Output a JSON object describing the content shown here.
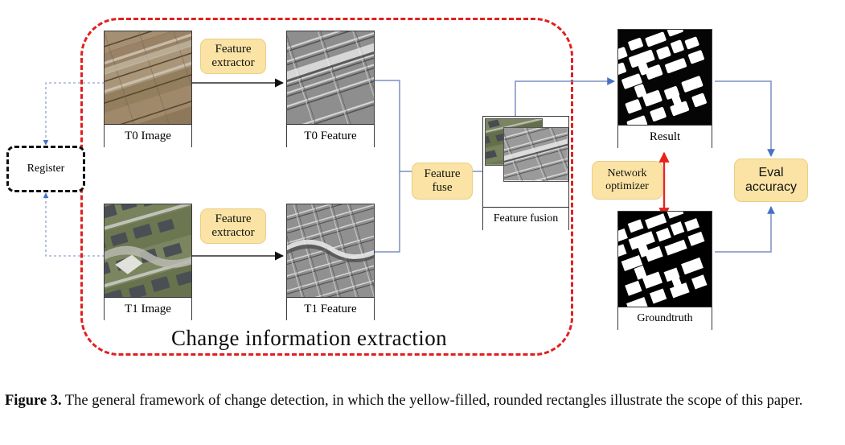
{
  "figure": {
    "scope_label": "Change  information  extraction",
    "caption_lead": "Figure 3.",
    "caption_text": " The general framework of change detection, in which the yellow-filled, rounded rectangles illustrate the scope of this paper."
  },
  "colors": {
    "process_fill": "#FAE3A4",
    "process_border": "#EACE84",
    "scope_border": "#E02020",
    "wire_blue": "#7C8FC4",
    "wire_black": "#2B2B2B",
    "arrow_red": "#E8231A",
    "register_border": "#111111"
  },
  "nodes": {
    "register": {
      "label": "Register"
    },
    "t0_image": {
      "label": "T0 Image"
    },
    "t1_image": {
      "label": "T1 Image"
    },
    "t0_feature": {
      "label": "T0 Feature"
    },
    "t1_feature": {
      "label": "T1 Feature"
    },
    "feature_fusion": {
      "label": "Feature fusion"
    },
    "result": {
      "label": "Result"
    },
    "groundtruth": {
      "label": "Groundtruth"
    }
  },
  "processes": [
    {
      "id": "feature-extractor-top",
      "line1": "Feature",
      "line2": "extractor"
    },
    {
      "id": "feature-extractor-bottom",
      "line1": "Feature",
      "line2": "extractor"
    },
    {
      "id": "feature-fuse",
      "line1": "Feature",
      "line2": "fuse"
    },
    {
      "id": "network-optimizer",
      "line1": "Network",
      "line2": "optimizer"
    },
    {
      "id": "eval-accuracy",
      "line1": "Eval",
      "line2": "accuracy"
    }
  ]
}
